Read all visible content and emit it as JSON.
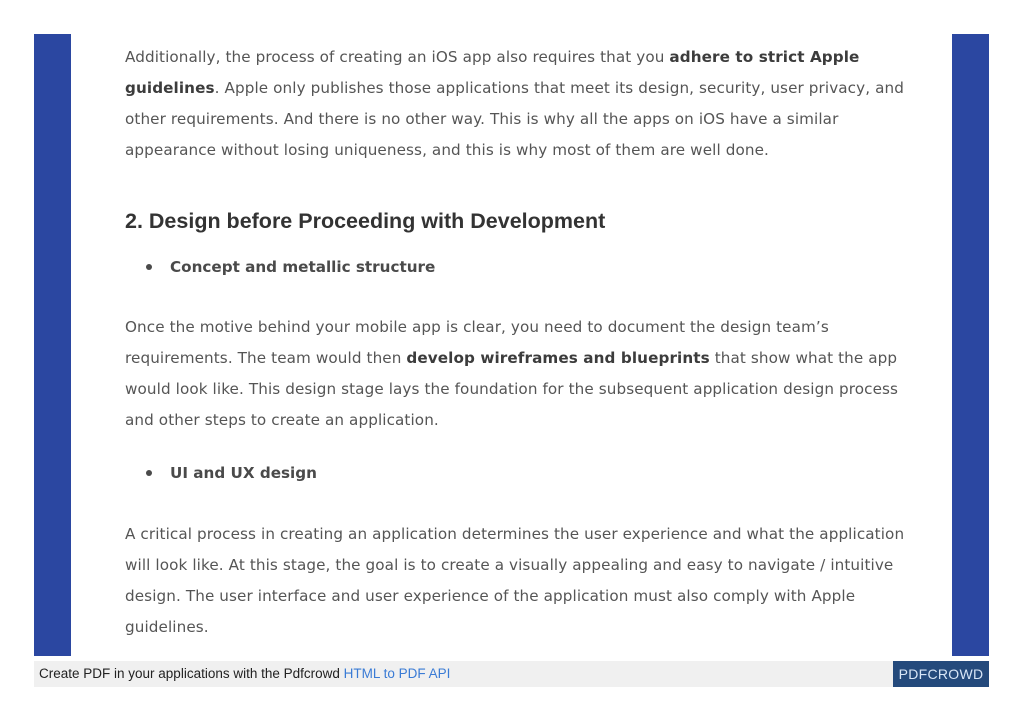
{
  "article": {
    "para1": {
      "part1": "Additionally, the process of creating an iOS app also requires that you ",
      "bold": "adhere to strict Apple guidelines",
      "part2": ". Apple only publishes those applications that meet its design, security, user privacy, and other requirements. And there is no other way. This is why all the apps on iOS have a similar appearance without losing uniqueness, and this is why most of them are well done."
    },
    "heading2": "2. Design before Proceeding with Development",
    "bullet1": "Concept and metallic structure",
    "para2": {
      "part1": "Once the motive behind your mobile app is clear, you need to document the design team’s requirements. The team would then ",
      "bold": "develop wireframes and blueprints",
      "part2": " that show what the app would look like. This design stage lays the foundation for the subsequent application design process and other steps to create an application."
    },
    "bullet2": "UI and UX design",
    "para3": "A critical process in creating an application determines the user experience and what the application will look like. At this stage, the goal is to create a visually appealing and easy to navigate / intuitive design. The user interface and user experience of the application must also comply with Apple guidelines."
  },
  "footer": {
    "text": "Create PDF in your applications with the Pdfcrowd ",
    "link": "HTML to PDF API",
    "brand": "PDFCROWD"
  },
  "colors": {
    "side_bar": "#2b47a1",
    "footer_brand_bg": "#244a7c",
    "link": "#3a7bd5"
  }
}
